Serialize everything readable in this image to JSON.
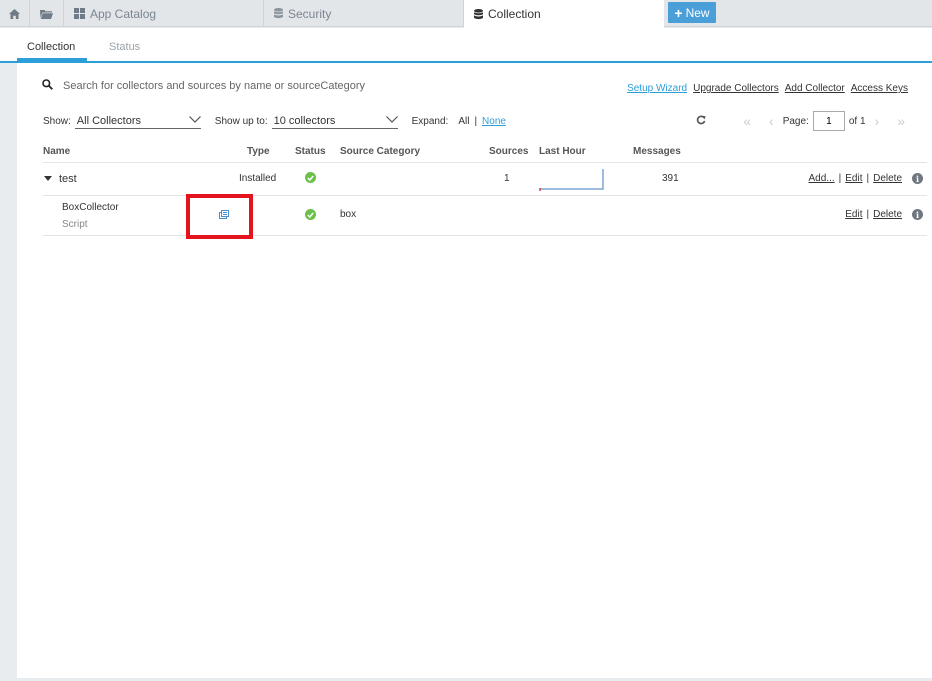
{
  "topbar": {
    "tabs": [
      {
        "label": "App Catalog"
      },
      {
        "label": "Security"
      },
      {
        "label": "Collection"
      }
    ],
    "new_label": "New"
  },
  "subtabs": {
    "collection": "Collection",
    "status": "Status"
  },
  "search": {
    "placeholder": "Search for collectors and sources by name or sourceCategory"
  },
  "links": {
    "setup_wizard": "Setup Wizard",
    "upgrade_collectors": "Upgrade Collectors",
    "add_collector": "Add Collector",
    "access_keys": "Access Keys"
  },
  "filters": {
    "show_label": "Show:",
    "show_value": "All Collectors",
    "upto_label": "Show up to:",
    "upto_value": "10 collectors",
    "expand_label": "Expand:",
    "expand_all": "All",
    "expand_sep": "|",
    "expand_none": "None"
  },
  "pager": {
    "page_label": "Page:",
    "page_value": "1",
    "of_label": "of 1"
  },
  "table": {
    "headers": {
      "name": "Name",
      "type": "Type",
      "status": "Status",
      "source_category": "Source Category",
      "sources": "Sources",
      "last_hour": "Last Hour",
      "messages": "Messages"
    },
    "collector": {
      "name": "test",
      "type": "Installed",
      "sources": "1",
      "messages": "391",
      "actions": {
        "add": "Add...",
        "edit": "Edit",
        "delete": "Delete",
        "sep": "|"
      }
    },
    "source": {
      "name": "BoxCollector",
      "subtype": "Script",
      "source_category": "box",
      "actions": {
        "edit": "Edit",
        "delete": "Delete",
        "sep": "|"
      }
    }
  },
  "colors": {
    "accent": "#2c9fd9",
    "new_button": "#4a9fd8",
    "status_ok": "#6cc04a",
    "highlight": "#e3141e"
  }
}
